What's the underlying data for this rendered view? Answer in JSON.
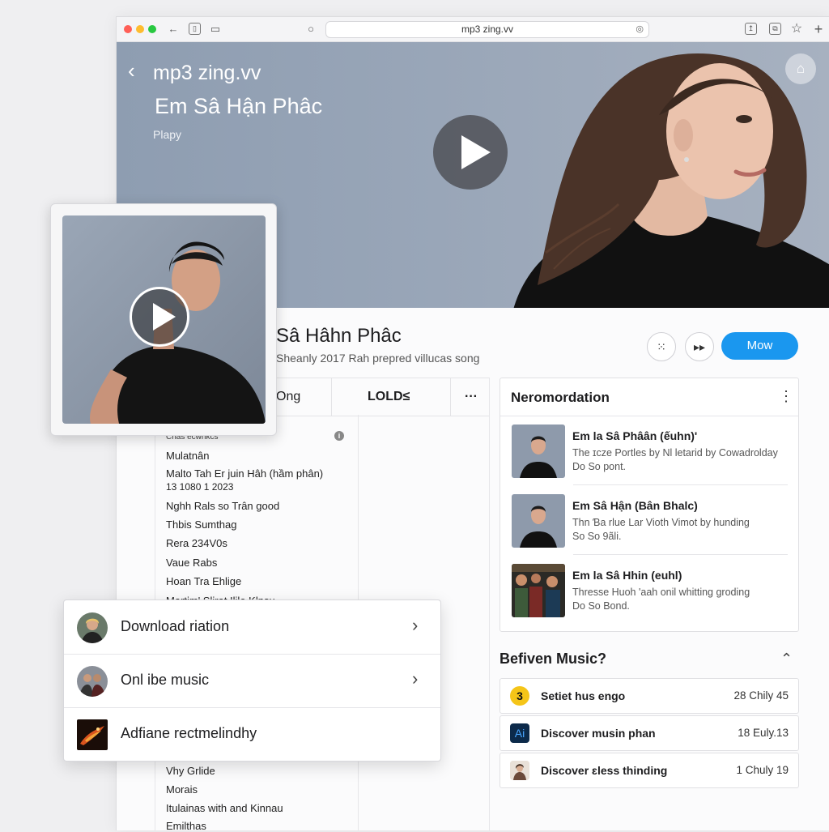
{
  "browser": {
    "url": "mp3 zing.vv"
  },
  "hero": {
    "site_name": "mp3 zing.vv",
    "title": "Em Sâ Hận Phâc",
    "subtitle": "Plapy"
  },
  "song": {
    "title": "Sâ Hâhn Phâc",
    "subtitle": "Sheanly 2017 Rah prepred villucas song",
    "now_label": "Mow"
  },
  "tabs": [
    {
      "label": "Ong"
    },
    {
      "label": "LOLD≤"
    },
    {
      "label": "···"
    }
  ],
  "list": {
    "header": "Ƈnas ecwnkcs",
    "items_top": [
      "Mulatnân",
      "Malto Tah Er juin Hâh (hầm phân)",
      "13 1080 1 2023",
      "Nghh Rals so Trân good",
      "Thbis Sumthag",
      "Rera 234V0s",
      "Vaue Rabs",
      "Hoan Tra Ehlige",
      "Martim' Slirat Ilile Klnsu"
    ],
    "items_bottom": [
      "Vhy Grlide",
      "Morais",
      "Itulainas with and Kinnau",
      "Emilthas"
    ]
  },
  "recommendation": {
    "title": "Neromordation",
    "items": [
      {
        "name": "Em la Sâ Phâân (ếuhn)'",
        "desc1": "The ɪcze Portles by Nl letarid by Cowadrolday",
        "desc2": "Do So pont."
      },
      {
        "name": "Em Sâ Hận (Bân Bhalc)",
        "desc1": "Thn Ɓa rlue Lar Vioth Vimot by hunding",
        "desc2": "So So 9ãli."
      },
      {
        "name": "Em la Sâ Hhin (euhl)",
        "desc1": "Thresse Huoh 'aah onil whitting groding",
        "desc2": "Do So Bond."
      }
    ]
  },
  "behind_music": {
    "title": "Befiven Music?",
    "rows": [
      {
        "badge": "3",
        "label": "Setiet hus engo",
        "date": "28 Chily 45"
      },
      {
        "badge": "Ai",
        "label": "Discover musin phan",
        "date": "18 Euly.13"
      },
      {
        "badge": "",
        "label": "Discover ɛless thinding",
        "date": "1 Chuly 19"
      }
    ]
  },
  "menu": {
    "items": [
      {
        "label": "Download riation"
      },
      {
        "label": "Onl ibe music"
      },
      {
        "label": "Adfiane rectmelindhy"
      }
    ]
  },
  "colors": {
    "accent": "#1a97ef",
    "hero_bg": "#99a6b8",
    "badge_yellow": "#f5c518",
    "badge_ai": "#0c2a4a"
  }
}
